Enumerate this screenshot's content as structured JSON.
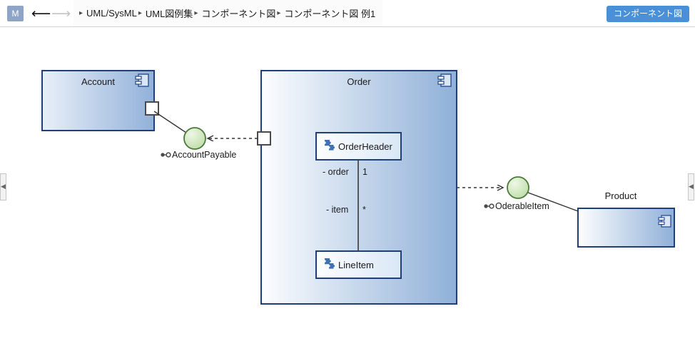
{
  "topbar": {
    "logo": "M",
    "back_icon": "arrow-left",
    "forward_icon": "arrow-right",
    "breadcrumb": [
      "UML/SysML",
      "UML図例集",
      "コンポーネント図",
      "コンポーネント図 例1"
    ],
    "diagram_type_button": "コンポーネント図"
  },
  "palette": {
    "tools": [
      {
        "name": "package-tool",
        "icon": "folder-icon"
      },
      {
        "name": "component-tool",
        "icon": "component-icon"
      },
      {
        "name": "component-blue-tool",
        "icon": "puzzle-icon"
      },
      {
        "name": "interface-tool",
        "icon": "lollipop-icon"
      },
      {
        "name": "note-tool",
        "icon": "note-icon"
      },
      {
        "name": "port-tool",
        "icon": "port-icon"
      },
      {
        "name": "rectangle-tool",
        "icon": "rectangle-icon"
      }
    ]
  },
  "canvas": {
    "collapse_left_icon": "chevron-left-icon",
    "collapse_right_icon": "chevron-left-icon",
    "components": [
      {
        "id": "account",
        "title": "Account",
        "icon": "component-icon"
      },
      {
        "id": "order",
        "title": "Order",
        "icon": "component-icon"
      },
      {
        "id": "product",
        "title": "Product",
        "icon": "component-icon"
      }
    ],
    "inner_components": [
      {
        "id": "orderheader",
        "title": "OrderHeader",
        "icon": "puzzle-icon"
      },
      {
        "id": "lineitem",
        "title": "LineItem",
        "icon": "puzzle-icon"
      }
    ],
    "interfaces": [
      {
        "id": "accountpayable",
        "label": "AccountPayable",
        "icon": "lollipop-icon"
      },
      {
        "id": "oderableitem",
        "label": "OderableItem",
        "icon": "lollipop-icon"
      }
    ],
    "association": {
      "role_source": "- order",
      "multiplicity_source": "1",
      "role_target": "- item",
      "multiplicity_target": "*"
    }
  },
  "colors": {
    "accent_blue": "#4a90d9",
    "component_border": "#1f3f7a",
    "component_fill_light": "#fdfeff",
    "component_fill_dark": "#8fb0d8",
    "interface_fill": "#cfe8bd",
    "interface_border": "#4a7a3a",
    "port_border": "#4a4a4a",
    "connector": "#333333"
  }
}
